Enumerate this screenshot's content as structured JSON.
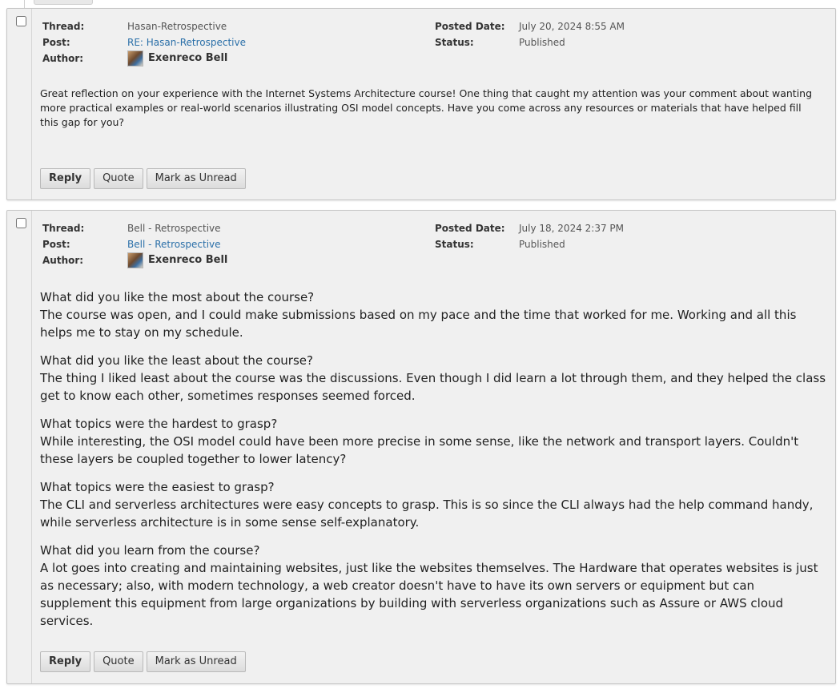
{
  "labels": {
    "thread": "Thread:",
    "post": "Post:",
    "author": "Author:",
    "posted_date": "Posted Date:",
    "status": "Status:"
  },
  "buttons": {
    "reply": "Reply",
    "quote": "Quote",
    "mark_unread": "Mark as Unread"
  },
  "posts": [
    {
      "thread": "Hasan-Retrospective",
      "post": "RE: Hasan-Retrospective",
      "author": "Exenreco Bell",
      "posted_date": "July 20, 2024 8:55 AM",
      "status": "Published",
      "body": "Great reflection on your experience with the Internet Systems Architecture course! One thing that caught my attention was your comment about wanting more practical examples or real-world scenarios illustrating OSI model concepts. Have you come across any resources or materials that have helped fill this gap for you?"
    },
    {
      "thread": "Bell - Retrospective",
      "post": "Bell - Retrospective",
      "author": "Exenreco Bell",
      "posted_date": "July 18, 2024 2:37 PM",
      "status": "Published",
      "qa": [
        {
          "q": "What did you like the most about the course?",
          "a": "The course was open, and I  could make submissions based on my pace and the time that worked for me. Working and all this helps me to stay on my schedule."
        },
        {
          "q": "What did you like the least about the course?",
          "a": "The thing I liked least about the course was the discussions. Even though I did learn a lot through them, and they helped the class get to know each other, sometimes responses seemed forced."
        },
        {
          "q": "What topics were the hardest to grasp?",
          "a": "While interesting, the OSI model could have been more precise in some sense, like the network and transport layers. Couldn't these layers be coupled together to lower latency?"
        },
        {
          "q": "What topics were the easiest to grasp?",
          "a": "The CLI and serverless architectures were easy concepts to grasp. This is so since the CLI always had the help command handy, while serverless architecture is in some sense self-explanatory."
        },
        {
          "q": "What did you learn from the course?",
          "a": "A lot goes into creating and maintaining websites, just like the websites themselves. The Hardware that operates websites is just as necessary; also, with modern technology, a web creator doesn't have to have its own servers or equipment but can supplement this equipment from large organizations by building with serverless organizations such as Assure or AWS cloud services."
        }
      ]
    }
  ]
}
